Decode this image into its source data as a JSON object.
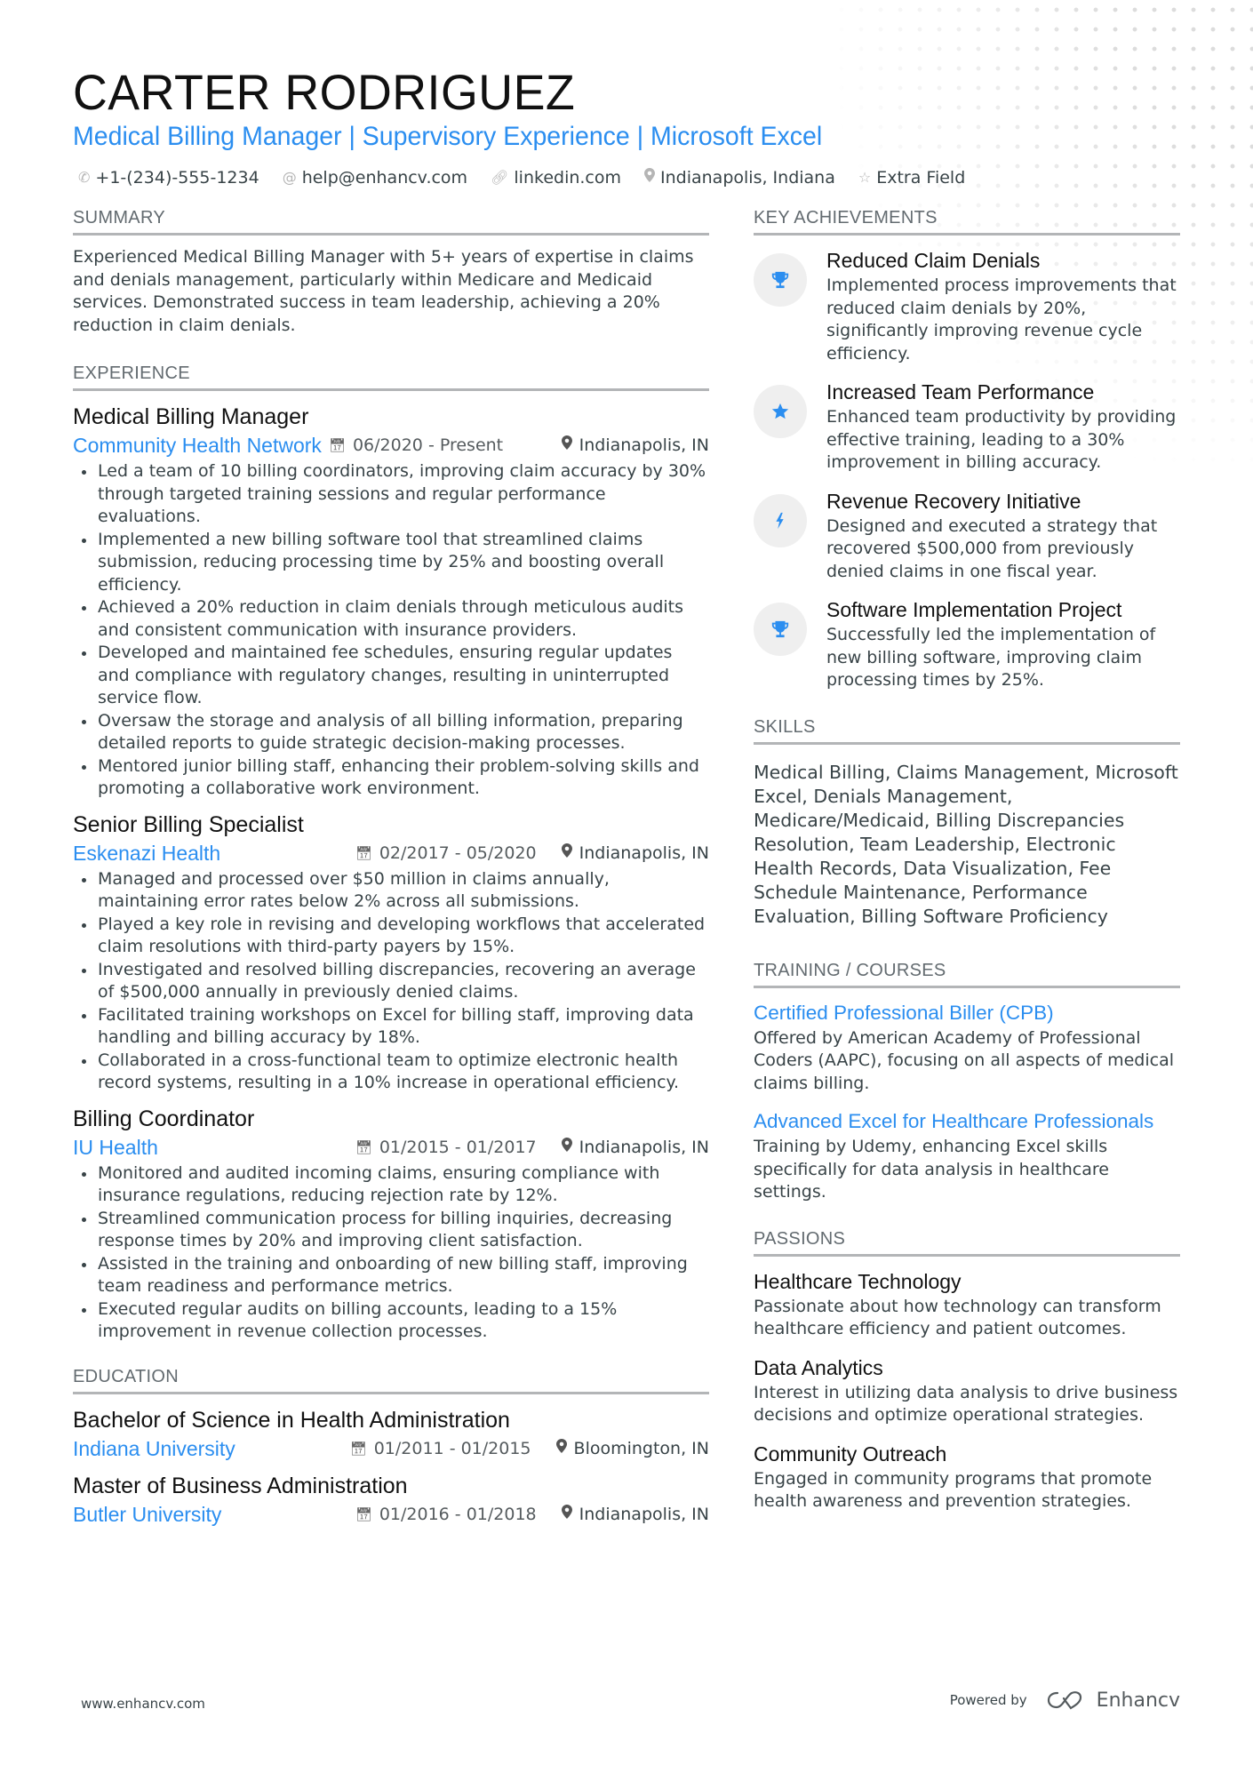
{
  "header": {
    "name": "CARTER RODRIGUEZ",
    "headline": "Medical Billing Manager | Supervisory Experience | Microsoft Excel",
    "contacts": [
      {
        "icon": "phone-icon",
        "text": "+1-(234)-555-1234"
      },
      {
        "icon": "at-icon",
        "text": "help@enhancv.com"
      },
      {
        "icon": "link-icon",
        "text": "linkedin.com"
      },
      {
        "icon": "location-icon",
        "text": "Indianapolis, Indiana"
      },
      {
        "icon": "star-outline-icon",
        "text": "Extra Field"
      }
    ]
  },
  "colors": {
    "accent": "#2b8ef0",
    "heading": "#111111",
    "body_text": "#384347",
    "section_rule": "#b3b5b7",
    "icon_circle": "#efefef"
  },
  "summary": {
    "title": "SUMMARY",
    "text": "Experienced Medical Billing Manager with 5+ years of expertise in claims and denials management, particularly within Medicare and Medicaid services. Demonstrated success in team leadership, achieving a 20% reduction in claim denials."
  },
  "experience": {
    "title": "EXPERIENCE",
    "jobs": [
      {
        "title": "Medical Billing Manager",
        "company": "Community Health Network",
        "dates": "06/2020 - Present",
        "location": "Indianapolis, IN",
        "bullets": [
          "Led a team of 10 billing coordinators, improving claim accuracy by 30% through targeted training sessions and regular performance evaluations.",
          "Implemented a new billing software tool that streamlined claims submission, reducing processing time by 25% and boosting overall efficiency.",
          "Achieved a 20% reduction in claim denials through meticulous audits and consistent communication with insurance providers.",
          "Developed and maintained fee schedules, ensuring regular updates and compliance with regulatory changes, resulting in uninterrupted service flow.",
          "Oversaw the storage and analysis of all billing information, preparing detailed reports to guide strategic decision-making processes.",
          "Mentored junior billing staff, enhancing their problem-solving skills and promoting a collaborative work environment."
        ]
      },
      {
        "title": "Senior Billing Specialist",
        "company": "Eskenazi Health",
        "dates": "02/2017 - 05/2020",
        "location": "Indianapolis, IN",
        "bullets": [
          "Managed and processed over $50 million in claims annually, maintaining error rates below 2% across all submissions.",
          "Played a key role in revising and developing workflows that accelerated claim resolutions with third-party payers by 15%.",
          "Investigated and resolved billing discrepancies, recovering an average of $500,000 annually in previously denied claims.",
          "Facilitated training workshops on Excel for billing staff, improving data handling and billing accuracy by 18%.",
          "Collaborated in a cross-functional team to optimize electronic health record systems, resulting in a 10% increase in operational efficiency."
        ]
      },
      {
        "title": "Billing Coordinator",
        "company": "IU Health",
        "dates": "01/2015 - 01/2017",
        "location": "Indianapolis, IN",
        "bullets": [
          "Monitored and audited incoming claims, ensuring compliance with insurance regulations, reducing rejection rate by 12%.",
          "Streamlined communication process for billing inquiries, decreasing response times by 20% and improving client satisfaction.",
          "Assisted in the training and onboarding of new billing staff, improving team readiness and performance metrics.",
          "Executed regular audits on billing accounts, leading to a 15% improvement in revenue collection processes."
        ]
      }
    ]
  },
  "education": {
    "title": "EDUCATION",
    "items": [
      {
        "degree": "Bachelor of Science in Health Administration",
        "school": "Indiana University",
        "dates": "01/2011 - 01/2015",
        "location": "Bloomington, IN"
      },
      {
        "degree": "Master of Business Administration",
        "school": "Butler University",
        "dates": "01/2016 - 01/2018",
        "location": "Indianapolis, IN"
      }
    ]
  },
  "achievements": {
    "title": "KEY ACHIEVEMENTS",
    "items": [
      {
        "icon": "trophy-icon",
        "title": "Reduced Claim Denials",
        "desc": "Implemented process improvements that reduced claim denials by 20%, significantly improving revenue cycle efficiency."
      },
      {
        "icon": "star-icon",
        "title": "Increased Team Performance",
        "desc": "Enhanced team productivity by providing effective training, leading to a 30% improvement in billing accuracy."
      },
      {
        "icon": "lightning-icon",
        "title": "Revenue Recovery Initiative",
        "desc": "Designed and executed a strategy that recovered $500,000 from previously denied claims in one fiscal year."
      },
      {
        "icon": "trophy-icon",
        "title": "Software Implementation Project",
        "desc": "Successfully led the implementation of new billing software, improving claim processing times by 25%."
      }
    ]
  },
  "skills": {
    "title": "SKILLS",
    "text": "Medical Billing, Claims Management, Microsoft Excel, Denials Management, Medicare/Medicaid, Billing Discrepancies Resolution, Team Leadership, Electronic Health Records, Data Visualization, Fee Schedule Maintenance, Performance Evaluation, Billing Software Proficiency"
  },
  "training": {
    "title": "TRAINING / COURSES",
    "items": [
      {
        "title": "Certified Professional Biller (CPB)",
        "desc": "Offered by American Academy of Professional Coders (AAPC), focusing on all aspects of medical claims billing."
      },
      {
        "title": "Advanced Excel for Healthcare Professionals",
        "desc": "Training by Udemy, enhancing Excel skills specifically for data analysis in healthcare settings."
      }
    ]
  },
  "passions": {
    "title": "PASSIONS",
    "items": [
      {
        "title": "Healthcare Technology",
        "desc": "Passionate about how technology can transform healthcare efficiency and patient outcomes."
      },
      {
        "title": "Data Analytics",
        "desc": "Interest in utilizing data analysis to drive business decisions and optimize operational strategies."
      },
      {
        "title": "Community Outreach",
        "desc": "Engaged in community programs that promote health awareness and prevention strategies."
      }
    ]
  },
  "footer": {
    "website": "www.enhancv.com",
    "powered_by": "Powered by",
    "brand": "Enhancv"
  }
}
